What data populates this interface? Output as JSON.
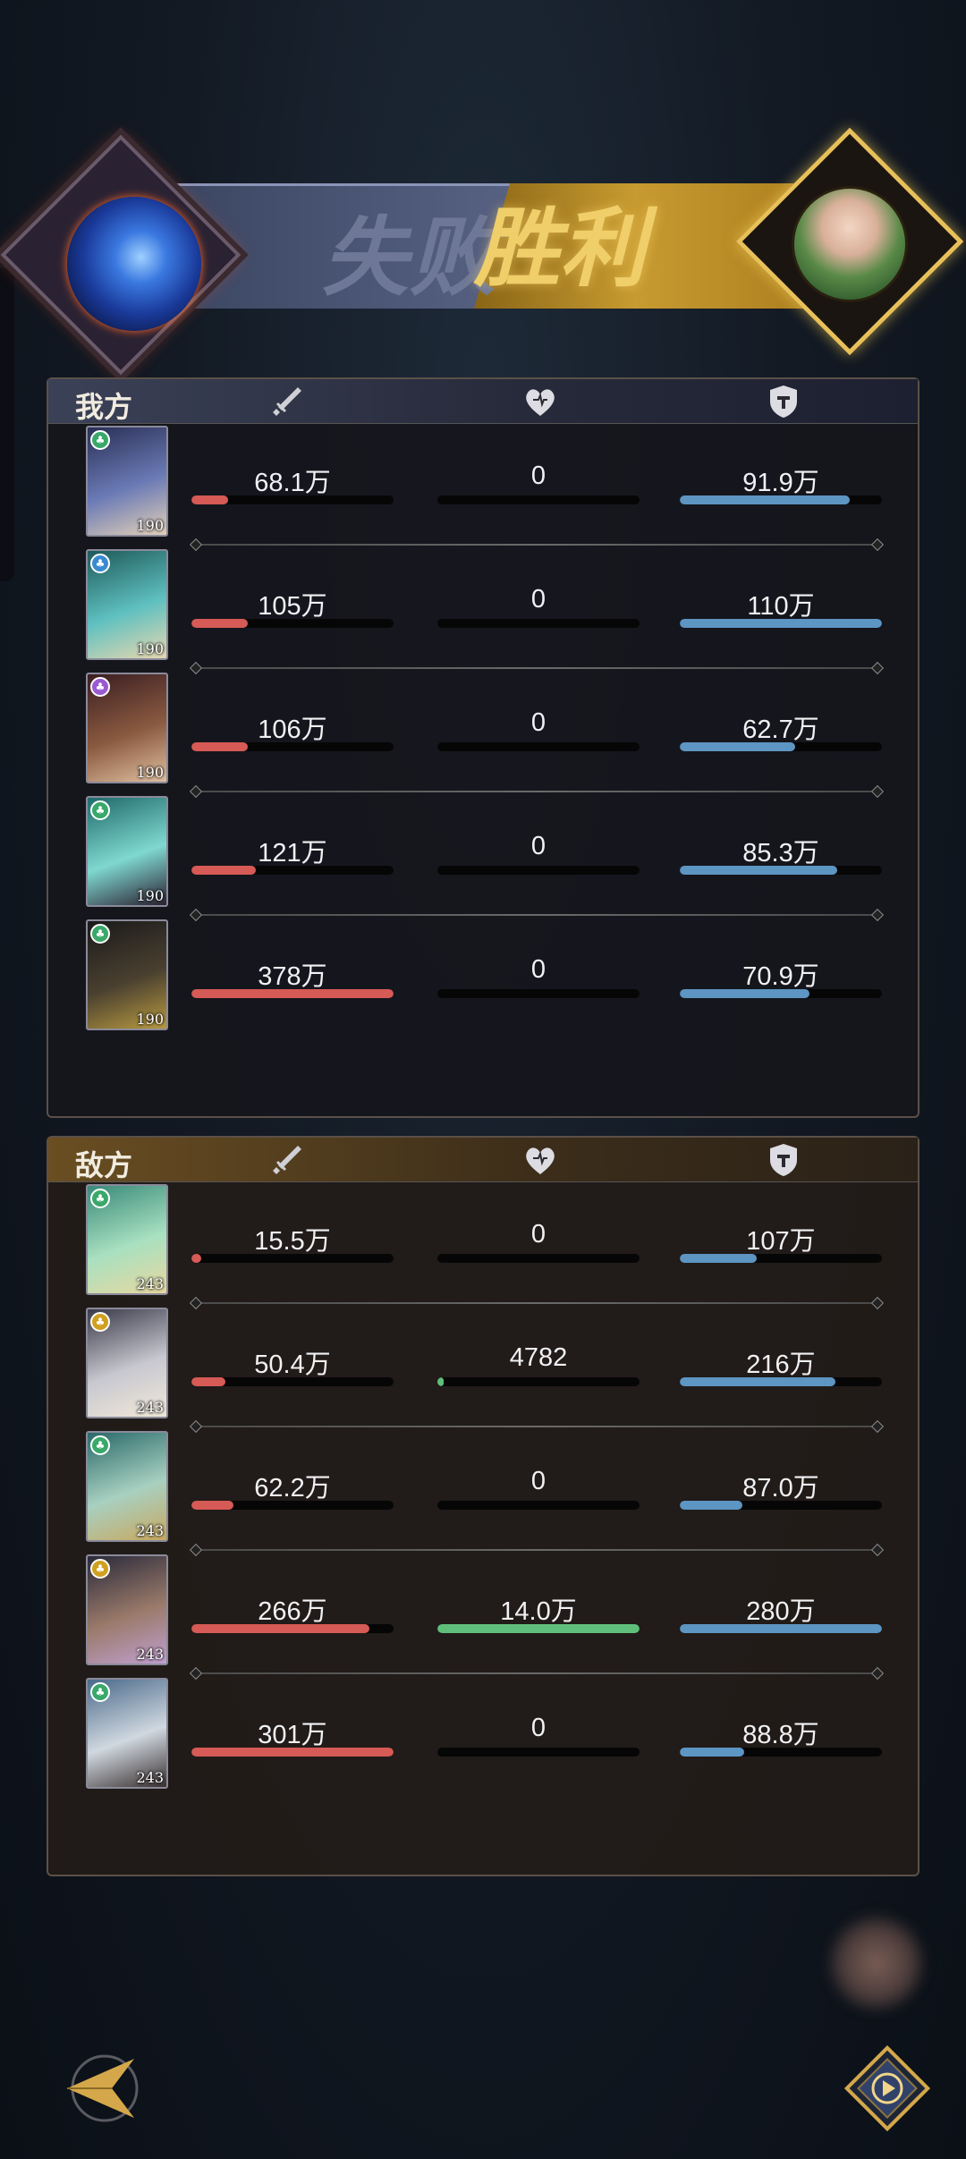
{
  "header": {
    "lose_label": "失败",
    "win_label": "胜利"
  },
  "colors": {
    "damage": "#d65a55",
    "heal": "#5fbf7a",
    "tank": "#5d95c3",
    "win_gold": "#f0cf6a",
    "lose_gray": "#6e7896"
  },
  "columns": {
    "damage_icon": "sword-icon",
    "heal_icon": "heart-icon",
    "tank_icon": "shield-icon"
  },
  "ours": {
    "title": "我方",
    "rows": [
      {
        "level": "190",
        "damage": "68.1万",
        "damage_pct": 0.18,
        "heal": "0",
        "heal_pct": 0,
        "tank": "91.9万",
        "tank_pct": 0.84
      },
      {
        "level": "190",
        "damage": "105万",
        "damage_pct": 0.28,
        "heal": "0",
        "heal_pct": 0,
        "tank": "110万",
        "tank_pct": 1.0
      },
      {
        "level": "190",
        "damage": "106万",
        "damage_pct": 0.28,
        "heal": "0",
        "heal_pct": 0,
        "tank": "62.7万",
        "tank_pct": 0.57
      },
      {
        "level": "190",
        "damage": "121万",
        "damage_pct": 0.32,
        "heal": "0",
        "heal_pct": 0,
        "tank": "85.3万",
        "tank_pct": 0.78
      },
      {
        "level": "190",
        "damage": "378万",
        "damage_pct": 1.0,
        "heal": "0",
        "heal_pct": 0,
        "tank": "70.9万",
        "tank_pct": 0.64
      }
    ]
  },
  "enemy": {
    "title": "敌方",
    "rows": [
      {
        "level": "243",
        "damage": "15.5万",
        "damage_pct": 0.05,
        "heal": "0",
        "heal_pct": 0,
        "tank": "107万",
        "tank_pct": 0.38
      },
      {
        "level": "243",
        "damage": "50.4万",
        "damage_pct": 0.17,
        "heal": "4782",
        "heal_pct": 0.03,
        "tank": "216万",
        "tank_pct": 0.77
      },
      {
        "level": "243",
        "damage": "62.2万",
        "damage_pct": 0.21,
        "heal": "0",
        "heal_pct": 0,
        "tank": "87.0万",
        "tank_pct": 0.31
      },
      {
        "level": "243",
        "damage": "266万",
        "damage_pct": 0.88,
        "heal": "14.0万",
        "heal_pct": 1.0,
        "tank": "280万",
        "tank_pct": 1.0
      },
      {
        "level": "243",
        "damage": "301万",
        "damage_pct": 1.0,
        "heal": "0",
        "heal_pct": 0,
        "tank": "88.8万",
        "tank_pct": 0.32
      }
    ]
  },
  "controls": {
    "back_icon": "back-arrow-icon",
    "replay_icon": "play-icon"
  }
}
